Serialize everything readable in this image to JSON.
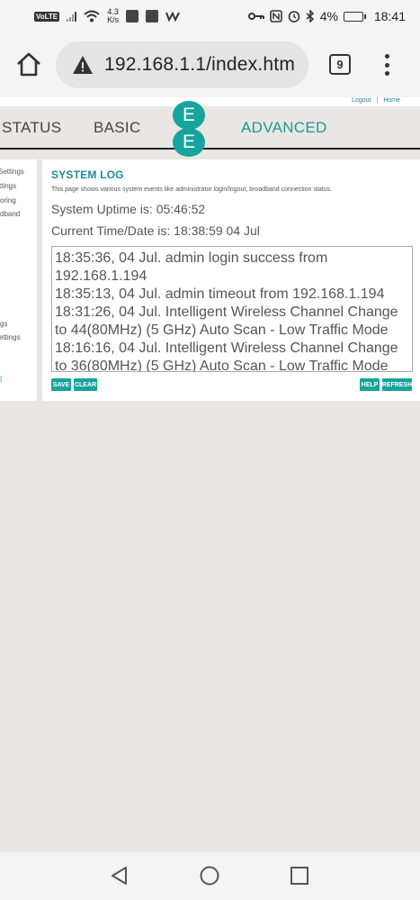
{
  "statusbar": {
    "volte": "VoLTE",
    "speed_value": "4.3",
    "speed_unit": "K/s",
    "battery": "4%",
    "time": "18:41",
    "icons": [
      "signal-icon",
      "wifi-icon",
      "app-icon",
      "app-icon",
      "wish-icon",
      "key-icon",
      "nfc-icon",
      "alarm-icon",
      "bluetooth-icon",
      "battery-icon"
    ]
  },
  "browser": {
    "url": "192.168.1.1/index.htm",
    "tab_count": "9"
  },
  "router": {
    "toplinks": {
      "logout": "Logout",
      "sep": "|",
      "home": "Home"
    },
    "nav": {
      "status": "STATUS",
      "basic": "BASIC",
      "advanced": "ADVANCED"
    },
    "logo": {
      "top": "E",
      "bottom": "E"
    },
    "sidebar": [
      "Settings",
      "ttings",
      "oring",
      "dband",
      "gs",
      "ettings"
    ],
    "page": {
      "title": "SYSTEM LOG",
      "description": "This page shows various system events like administrator login/logout, broadband connection status.",
      "uptime": "System Uptime is: 05:46:52",
      "current_time": "Current Time/Date is: 18:38:59 04 Jul",
      "log_lines": [
        "18:35:36, 04 Jul. admin login success from",
        "192.168.1.194",
        "18:35:13, 04 Jul. admin timeout from 192.168.1.194",
        "18:31:26, 04 Jul. Intelligent Wireless Channel Change",
        "to 44(80MHz) (5 GHz) Auto Scan - Low Traffic Mode",
        "18:16:16, 04 Jul. Intelligent Wireless Channel Change",
        "to 36(80MHz) (5 GHz) Auto Scan - Low Traffic Mode"
      ],
      "buttons": {
        "save": "SAVE",
        "clear": "CLEAR",
        "help": "HELP",
        "refresh": "REFRESH"
      }
    }
  },
  "colors": {
    "accent": "#16a49c",
    "title": "#1a8aa0"
  }
}
